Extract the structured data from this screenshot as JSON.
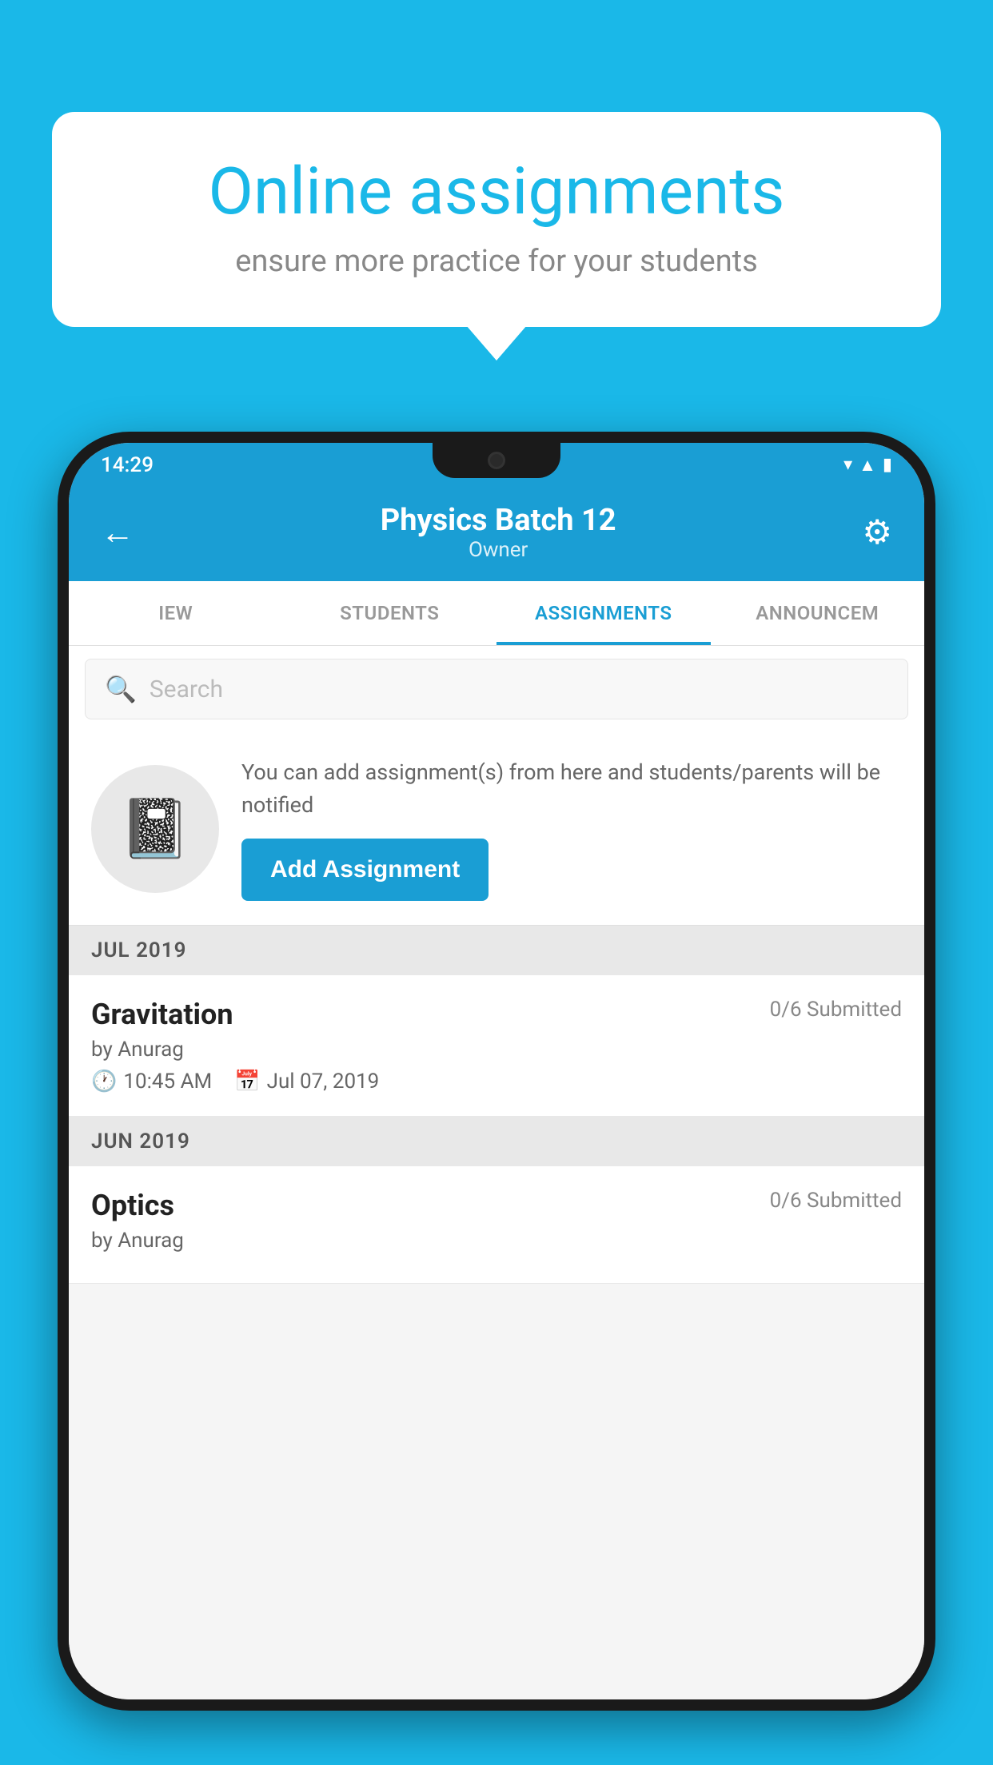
{
  "background_color": "#1ab8e8",
  "speech_bubble": {
    "title": "Online assignments",
    "subtitle": "ensure more practice for your students"
  },
  "status_bar": {
    "time": "14:29",
    "icons": [
      "wifi",
      "signal",
      "battery"
    ]
  },
  "header": {
    "title": "Physics Batch 12",
    "subtitle": "Owner",
    "back_label": "←",
    "settings_label": "⚙"
  },
  "tabs": [
    {
      "label": "IEW",
      "active": false
    },
    {
      "label": "STUDENTS",
      "active": false
    },
    {
      "label": "ASSIGNMENTS",
      "active": true
    },
    {
      "label": "ANNOUNCEM",
      "active": false
    }
  ],
  "search": {
    "placeholder": "Search"
  },
  "promo": {
    "description": "You can add assignment(s) from here and students/parents will be notified",
    "button_label": "Add Assignment"
  },
  "sections": [
    {
      "header": "JUL 2019",
      "assignments": [
        {
          "name": "Gravitation",
          "submitted": "0/6 Submitted",
          "by": "by Anurag",
          "time": "10:45 AM",
          "date": "Jul 07, 2019"
        }
      ]
    },
    {
      "header": "JUN 2019",
      "assignments": [
        {
          "name": "Optics",
          "submitted": "0/6 Submitted",
          "by": "by Anurag",
          "time": "",
          "date": ""
        }
      ]
    }
  ]
}
